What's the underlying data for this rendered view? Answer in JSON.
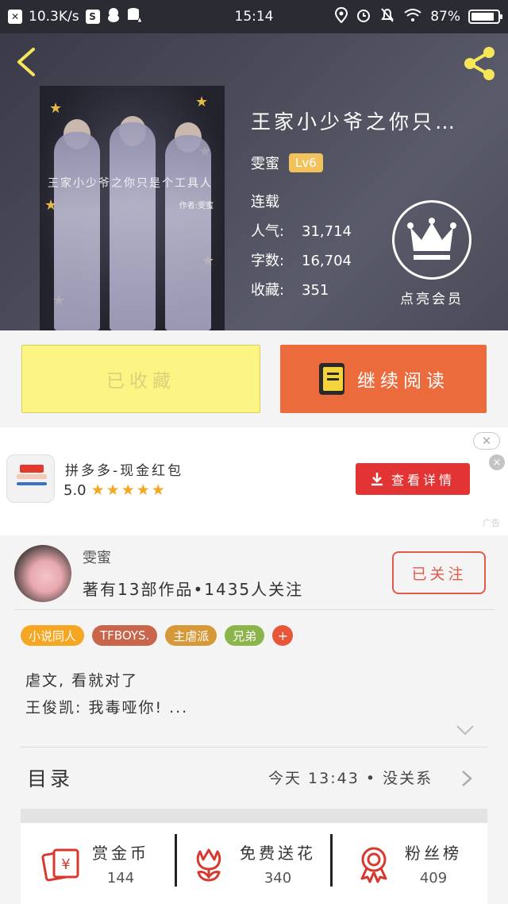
{
  "status_bar": {
    "speed": "10.3K/s",
    "time": "15:14",
    "battery": "87%",
    "battery_level": 0.87
  },
  "book": {
    "title": "王家小少爷之你只…",
    "cover_text": "王家小少爷之你只是个工具人",
    "cover_author": "作者:雯蜜",
    "author": "雯蜜",
    "level": "Lv6",
    "status": "连载",
    "stats": [
      {
        "label": "人气:",
        "value": "31,714"
      },
      {
        "label": "字数:",
        "value": "16,704"
      },
      {
        "label": "收藏:",
        "value": "351"
      }
    ]
  },
  "member": {
    "label": "点亮会员"
  },
  "actions": {
    "collected_label": "已收藏",
    "read_label": "继续阅读"
  },
  "ad": {
    "close_symbol": "✕",
    "close_x": "×",
    "title": "拼多多-现金红包",
    "rating": "5.0",
    "stars": "★★★★★",
    "button_label": "查看详情",
    "mark": "广告"
  },
  "author_card": {
    "name": "雯蜜",
    "info": "著有13部作品•1435人关注",
    "follow_label": "已关注"
  },
  "tags": [
    {
      "label": "小说同人",
      "color": "#f5a623"
    },
    {
      "label": "TFBOYS.",
      "color": "#c8654a"
    },
    {
      "label": "主虐派",
      "color": "#d6993a"
    },
    {
      "label": "兄弟",
      "color": "#8bb44a"
    },
    {
      "label": "+",
      "color": "#e8563a"
    }
  ],
  "description": {
    "line1": "虐文, 看就对了",
    "line2": "王俊凯: 我毒哑你! ..."
  },
  "toc": {
    "label": "目录",
    "latest": "今天 13:43 • 没关系"
  },
  "bottom_bar": [
    {
      "label": "赏金币",
      "value": "144",
      "icon": "coin-envelope-icon"
    },
    {
      "label": "免费送花",
      "value": "340",
      "icon": "flower-icon"
    },
    {
      "label": "粉丝榜",
      "value": "409",
      "icon": "medal-icon"
    }
  ],
  "colors": {
    "accent_orange": "#ec6b3c",
    "follow_red": "#e15a4a",
    "collected_yellow": "#fcf584",
    "icon_red": "#d8392f"
  }
}
